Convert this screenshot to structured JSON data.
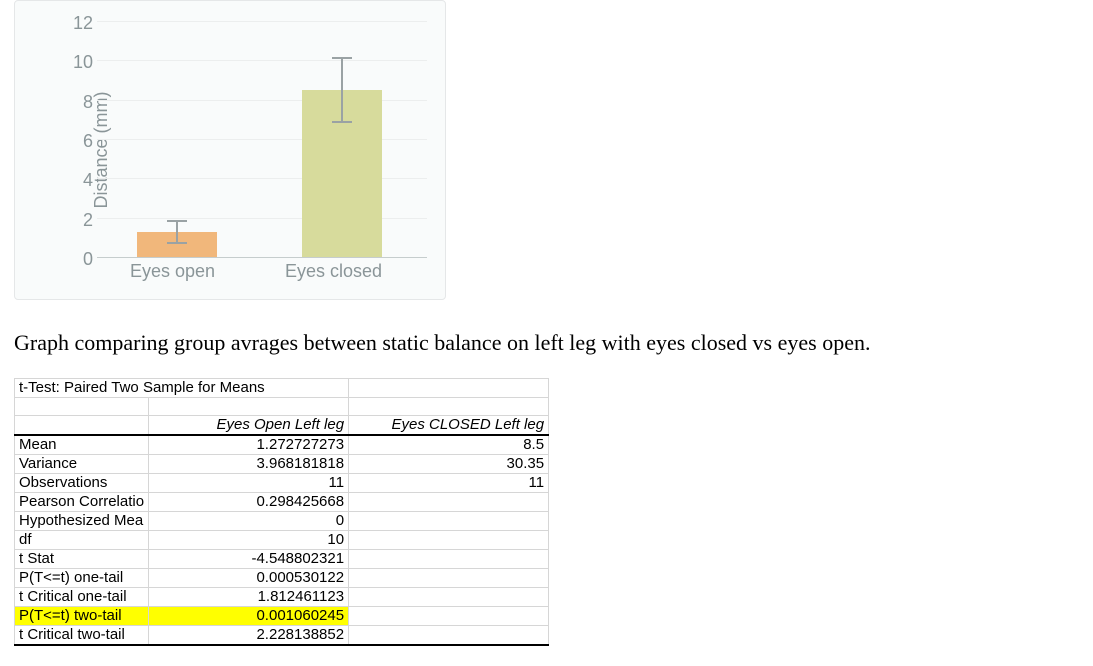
{
  "chart_data": {
    "type": "bar",
    "ylabel": "Distance (mm)",
    "ylim": [
      0,
      12
    ],
    "yticks": [
      0,
      2,
      4,
      6,
      8,
      10,
      12
    ],
    "categories": [
      "Eyes open",
      "Eyes closed"
    ],
    "values": [
      1.27,
      8.5
    ],
    "errors": [
      0.6,
      1.7
    ],
    "colors": [
      "#f1b77b",
      "#d7db9c"
    ]
  },
  "caption": "Graph comparing group avrages between static balance on left leg with eyes closed vs eyes open.",
  "ttest": {
    "title": "t-Test: Paired Two Sample for Means",
    "headers": [
      "Eyes Open Left leg",
      "Eyes CLOSED Left leg"
    ],
    "rows": [
      {
        "label": "Mean",
        "a": "1.272727273",
        "b": "8.5"
      },
      {
        "label": "Variance",
        "a": "3.968181818",
        "b": "30.35"
      },
      {
        "label": "Observations",
        "a": "11",
        "b": "11"
      },
      {
        "label": "Pearson Correlatio",
        "a": "0.298425668",
        "b": ""
      },
      {
        "label": "Hypothesized Mea",
        "a": "0",
        "b": ""
      },
      {
        "label": "df",
        "a": "10",
        "b": ""
      },
      {
        "label": "t Stat",
        "a": "-4.548802321",
        "b": ""
      },
      {
        "label": "P(T<=t) one-tail",
        "a": "0.000530122",
        "b": ""
      },
      {
        "label": "t Critical one-tail",
        "a": "1.812461123",
        "b": ""
      },
      {
        "label": "P(T<=t) two-tail",
        "a": "0.001060245",
        "b": "",
        "highlight": true
      },
      {
        "label": "t Critical two-tail",
        "a": "2.228138852",
        "b": ""
      }
    ]
  }
}
